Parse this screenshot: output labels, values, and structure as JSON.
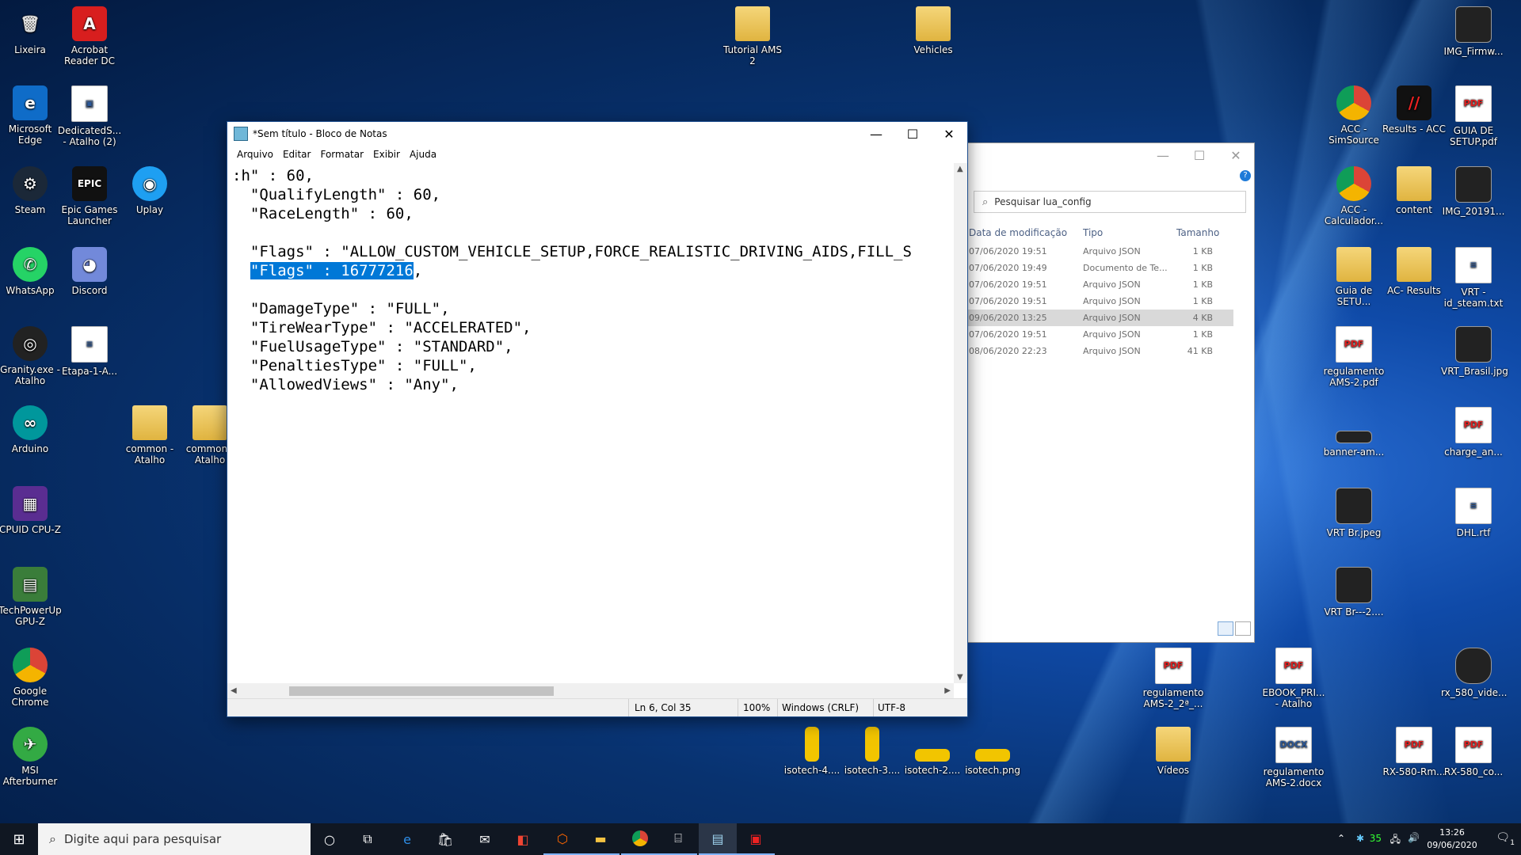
{
  "desktop": {
    "icons": [
      {
        "label": "Lixeira",
        "glyph": "🗑",
        "x": 0
      },
      {
        "label": "Acrobat Reader DC",
        "glyph": "A"
      },
      {
        "label": "Microsoft Edge",
        "glyph": "e"
      },
      {
        "label": "DedicatedS... - Atalho (2)",
        "glyph": "▣"
      },
      {
        "label": "Steam",
        "glyph": "⚙"
      },
      {
        "label": "Epic Games Launcher",
        "glyph": "EPIC"
      },
      {
        "label": "Uplay",
        "glyph": "◉"
      },
      {
        "label": "WhatsApp",
        "glyph": "✆"
      },
      {
        "label": "Discord",
        "glyph": "◕"
      },
      {
        "label": "Granity.exe - Atalho",
        "glyph": "◎"
      },
      {
        "label": "Etapa-1-A...",
        "glyph": "≡"
      },
      {
        "label": "Arduino",
        "glyph": "∞"
      },
      {
        "label": "common - Atalho",
        "glyph": ""
      },
      {
        "label": "common - Atalho",
        "glyph": ""
      },
      {
        "label": "CPUID CPU-Z",
        "glyph": "▦"
      },
      {
        "label": "TechPowerUp GPU-Z",
        "glyph": "▤"
      },
      {
        "label": "Google Chrome",
        "glyph": "◍"
      },
      {
        "label": "MSI Afterburner",
        "glyph": "✈"
      },
      {
        "label": "Tutorial AMS 2",
        "glyph": ""
      },
      {
        "label": "Vehicles",
        "glyph": ""
      },
      {
        "label": "IMG_Firmw...",
        "glyph": ""
      },
      {
        "label": "ACC - SimSource",
        "glyph": "◍"
      },
      {
        "label": "Results - ACC",
        "glyph": "//"
      },
      {
        "label": "GUIA DE SETUP.pdf",
        "glyph": "PDF"
      },
      {
        "label": "ACC - Calculador...",
        "glyph": "◍"
      },
      {
        "label": "content",
        "glyph": ""
      },
      {
        "label": "IMG_20191...",
        "glyph": ""
      },
      {
        "label": "Guia de SETU...",
        "glyph": ""
      },
      {
        "label": "AC- Results",
        "glyph": ""
      },
      {
        "label": "VRT - id_steam.txt",
        "glyph": "≡"
      },
      {
        "label": "regulamento AMS-2.pdf",
        "glyph": "PDF"
      },
      {
        "label": "VRT_Brasil.jpg",
        "glyph": ""
      },
      {
        "label": "banner-am...",
        "glyph": ""
      },
      {
        "label": "charge_an...",
        "glyph": "PDF"
      },
      {
        "label": "VRT Br.jpeg",
        "glyph": ""
      },
      {
        "label": "DHL.rtf",
        "glyph": "≡"
      },
      {
        "label": "VRT Br---2....",
        "glyph": ""
      },
      {
        "label": "regulamento AMS-2_2ª_...",
        "glyph": "PDF"
      },
      {
        "label": "EBOOK_PRI... - Atalho",
        "glyph": "PDF"
      },
      {
        "label": "rx_580_vide...",
        "glyph": ""
      },
      {
        "label": "isotech-4....",
        "glyph": ""
      },
      {
        "label": "isotech-3....",
        "glyph": ""
      },
      {
        "label": "isotech-2....",
        "glyph": ""
      },
      {
        "label": "isotech.png",
        "glyph": ""
      },
      {
        "label": "Vídeos",
        "glyph": ""
      },
      {
        "label": "regulamento AMS-2.docx",
        "glyph": "DOCX"
      },
      {
        "label": "RX-580-Rm...",
        "glyph": "PDF"
      },
      {
        "label": "RX-580_co...",
        "glyph": "PDF"
      }
    ]
  },
  "notepad": {
    "title": "*Sem título - Bloco de Notas",
    "menu": [
      "Arquivo",
      "Editar",
      "Formatar",
      "Exibir",
      "Ajuda"
    ],
    "lines": [
      ":h\" : 60,",
      "  \"QualifyLength\" : 60,",
      "  \"RaceLength\" : 60,",
      "",
      "  \"Flags\" : \"ALLOW_CUSTOM_VEHICLE_SETUP,FORCE_REALISTIC_DRIVING_AIDS,FILL_S",
      "",
      "",
      "  \"DamageType\" : \"FULL\",",
      "  \"TireWearType\" : \"ACCELERATED\",",
      "  \"FuelUsageType\" : \"STANDARD\",",
      "  \"PenaltiesType\" : \"FULL\",",
      "  \"AllowedViews\" : \"Any\","
    ],
    "selected_line_prefix": "  ",
    "selected_text": "\"Flags\" : 16777216",
    "selected_line_suffix": ",",
    "status": {
      "position": "Ln 6, Col 35",
      "zoom": "100%",
      "line_ending": "Windows (CRLF)",
      "encoding": "UTF-8"
    },
    "minimize": "—",
    "maximize": "☐",
    "close": "✕"
  },
  "explorer": {
    "search_placeholder": "Pesquisar lua_config",
    "columns": [
      "Data de modificação",
      "Tipo",
      "Tamanho"
    ],
    "rows": [
      {
        "date": "07/06/2020 19:51",
        "type": "Arquivo JSON",
        "size": "1 KB"
      },
      {
        "date": "07/06/2020 19:49",
        "type": "Documento de Te...",
        "size": "1 KB"
      },
      {
        "date": "07/06/2020 19:51",
        "type": "Arquivo JSON",
        "size": "1 KB"
      },
      {
        "date": "07/06/2020 19:51",
        "type": "Arquivo JSON",
        "size": "1 KB"
      },
      {
        "date": "09/06/2020 13:25",
        "type": "Arquivo JSON",
        "size": "4 KB"
      },
      {
        "date": "07/06/2020 19:51",
        "type": "Arquivo JSON",
        "size": "1 KB"
      },
      {
        "date": "08/06/2020 22:23",
        "type": "Arquivo JSON",
        "size": "41 KB"
      }
    ]
  },
  "taskbar": {
    "search_placeholder": "Digite aqui para pesquisar",
    "clock_time": "13:26",
    "clock_date": "09/06/2020",
    "tray_temp": "35",
    "notif_count": "1"
  }
}
